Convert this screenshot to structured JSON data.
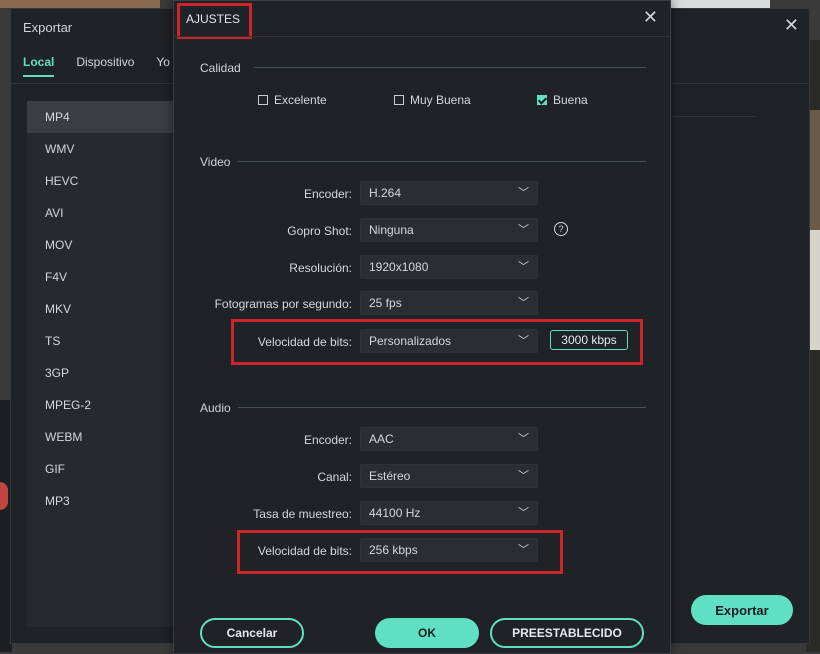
{
  "export_window": {
    "title": "Exportar",
    "tabs": [
      {
        "label": "Local",
        "active": true
      },
      {
        "label": "Dispositivo",
        "active": false
      },
      {
        "label": "Yo",
        "active": false
      }
    ],
    "formats": [
      "MP4",
      "WMV",
      "HEVC",
      "AVI",
      "MOV",
      "F4V",
      "MKV",
      "TS",
      "3GP",
      "MPEG-2",
      "WEBM",
      "GIF",
      "MP3"
    ],
    "selected_format": "MP4",
    "export_button": "Exportar"
  },
  "settings_dialog": {
    "title": "AJUSTES",
    "quality": {
      "section": "Calidad",
      "options": [
        {
          "label": "Excelente",
          "checked": false
        },
        {
          "label": "Muy Buena",
          "checked": false
        },
        {
          "label": "Buena",
          "checked": true
        }
      ]
    },
    "video": {
      "section": "Video",
      "encoder": {
        "label": "Encoder:",
        "value": "H.264"
      },
      "gopro": {
        "label": "Gopro Shot:",
        "value": "Ninguna"
      },
      "resolution": {
        "label": "Resolución:",
        "value": "1920x1080"
      },
      "fps": {
        "label": "Fotogramas por segundo:",
        "value": "25 fps"
      },
      "bitrate": {
        "label": "Velocidad de bits:",
        "value": "Personalizados",
        "custom_value": "3000 kbps"
      }
    },
    "audio": {
      "section": "Audio",
      "encoder": {
        "label": "Encoder:",
        "value": "AAC"
      },
      "channel": {
        "label": "Canal:",
        "value": "Estéreo"
      },
      "sample_rate": {
        "label": "Tasa de muestreo:",
        "value": "44100 Hz"
      },
      "bitrate": {
        "label": "Velocidad de bits:",
        "value": "256 kbps"
      }
    },
    "buttons": {
      "cancel": "Cancelar",
      "ok": "OK",
      "preset": "PREESTABLECIDO"
    }
  },
  "icons": {
    "close": "close-icon",
    "chevron": "chevron-down-icon",
    "help": "help-icon",
    "check": "check-icon"
  },
  "colors": {
    "accent": "#5fe0c2",
    "highlight": "#d0242b",
    "panel": "#1f2226"
  }
}
